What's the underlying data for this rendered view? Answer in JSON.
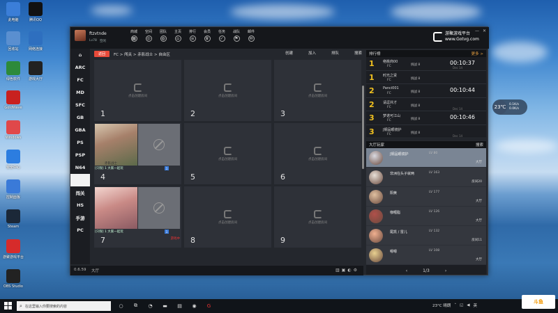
{
  "desktop": {
    "icons": [
      {
        "label": "此电脑",
        "color": "#3b7ed8",
        "icon": "computer-icon"
      },
      {
        "label": "腾讯QQ",
        "color": "#111111",
        "icon": "qq-icon"
      },
      {
        "label": "回收站",
        "color": "#5a8fd0",
        "icon": "recycle-bin-icon"
      },
      {
        "label": "网络连接",
        "color": "#2e6fbf",
        "icon": "network-icon"
      },
      {
        "label": "绿色软件",
        "color": "#2d8a3a",
        "icon": "app-icon"
      },
      {
        "label": "游戏大厅",
        "color": "#222222",
        "icon": "game-icon"
      },
      {
        "label": "GoldWave",
        "color": "#c8211f",
        "icon": "audio-icon"
      },
      {
        "label": "Windows",
        "color": "#e0484a",
        "icon": "photos-icon"
      },
      {
        "label": "安全中心",
        "color": "#2c7de0",
        "icon": "shield-icon"
      },
      {
        "label": "控制面板",
        "color": "#3a7ad8",
        "icon": "settings-icon"
      },
      {
        "label": "Steam",
        "color": "#1b2838",
        "icon": "steam-icon"
      },
      {
        "label": "游聚游戏平台",
        "color": "#d62b2b",
        "icon": "gotvg-icon"
      },
      {
        "label": "OBS Studio",
        "color": "#222222",
        "icon": "obs-icon"
      }
    ]
  },
  "window": {
    "user": {
      "name": "ftzvtnde",
      "level": "Lv78",
      "status": "空闲"
    },
    "nav": [
      {
        "label": "商城",
        "icon": "shop-icon"
      },
      {
        "label": "空间",
        "icon": "space-icon"
      },
      {
        "label": "团队",
        "icon": "team-icon"
      },
      {
        "label": "主页",
        "icon": "home-icon"
      },
      {
        "label": "排行",
        "icon": "rank-icon"
      },
      {
        "label": "会员",
        "icon": "vip-icon"
      },
      {
        "label": "任务",
        "icon": "task-icon"
      },
      {
        "label": "战队",
        "icon": "clan-icon"
      },
      {
        "label": "邮件",
        "icon": "mail-icon"
      }
    ],
    "brand": {
      "line1": "游聚游戏平台",
      "line2": "www.Gotvg.com"
    },
    "platforms": [
      "ARC",
      "FC",
      "MD",
      "SFC",
      "GB",
      "GBA",
      "PS",
      "PSP",
      "N64",
      "",
      "闯关",
      "HS",
      "手游",
      "PC"
    ],
    "active_platform_index": 9,
    "crumb": {
      "back": "返回",
      "path": "FC > 闯关 > 赤影战士 > 自由区"
    },
    "actions": [
      "创建",
      "加入",
      "排队",
      "搜索"
    ],
    "rooms": [
      {
        "num": "1",
        "cta": "点击创建房间"
      },
      {
        "num": "2",
        "cta": "点击创建房间"
      },
      {
        "num": "3",
        "cta": "点击创建房间"
      },
      {
        "num": "4",
        "occupied": true,
        "title": "赤影战士",
        "info": "[只限] 1 大家一起玩",
        "badge": "1"
      },
      {
        "num": "5",
        "cta": "点击创建房间"
      },
      {
        "num": "6",
        "cta": "点击创建房间"
      },
      {
        "num": "7",
        "occupied": true,
        "title": "",
        "info": "[只限] 1 大家一起玩",
        "badge": "1",
        "red": "游戏中"
      },
      {
        "num": "8",
        "cta": "点击创建房间"
      },
      {
        "num": "9",
        "cta": "点击创建房间"
      }
    ],
    "ranking": {
      "title": "排行榜",
      "more": "更多 >",
      "rows": [
        {
          "rank": "1",
          "name": "络桃商00",
          "tag": "FC",
          "detail": "挑战 8",
          "time": "00:10:37",
          "date": "Dec 14"
        },
        {
          "rank": "1",
          "name": "时光之贤",
          "tag": "FC",
          "detail": "挑战 8",
          "time": "",
          "date": ""
        },
        {
          "rank": "2",
          "name": "Panci001",
          "tag": "FC",
          "detail": "挑战 8",
          "time": "00:10:44",
          "date": ""
        },
        {
          "rank": "2",
          "name": "请逗共才",
          "tag": "FC",
          "detail": "挑战 8",
          "time": "",
          "date": "Dec 14"
        },
        {
          "rank": "3",
          "name": "梦诺可江山",
          "tag": "FC",
          "detail": "挑战 8",
          "time": "00:10:46",
          "date": ""
        },
        {
          "rank": "3",
          "name": "J钢品眼镜护",
          "tag": "FC",
          "detail": "挑战 8",
          "time": "",
          "date": "Dec 14"
        }
      ]
    },
    "lobby": {
      "title": "大厅玩家",
      "search": "搜索",
      "players": [
        {
          "name": "J钢品眼镜护",
          "level": "LV 80",
          "status": "大厅",
          "selected": true
        },
        {
          "name": "非洲在头子就两",
          "level": "LV 163",
          "status": "房间20",
          "selected": false
        },
        {
          "name": "阳黄",
          "level": "LV 177",
          "status": "大厅",
          "selected": false
        },
        {
          "name": "咖喱脂",
          "level": "LV 126",
          "status": "大厅",
          "selected": false
        },
        {
          "name": "尾凯 / 雷儿",
          "level": "LV 132",
          "status": "房间11",
          "selected": false
        },
        {
          "name": "嗯嗯",
          "level": "LV 108",
          "status": "大厅",
          "selected": false
        }
      ],
      "page": "1/3"
    },
    "footer": {
      "version": "0.6.59",
      "state": "大厅"
    }
  },
  "gadget": {
    "temp": "23℃",
    "line1": "0.1K/s",
    "line2": "0.0K/s"
  },
  "taskbar": {
    "search_placeholder": "在这里输入你要搜索的内容",
    "weather": "23°C 晴朗",
    "ime": "英",
    "watermark": "斗鱼"
  }
}
